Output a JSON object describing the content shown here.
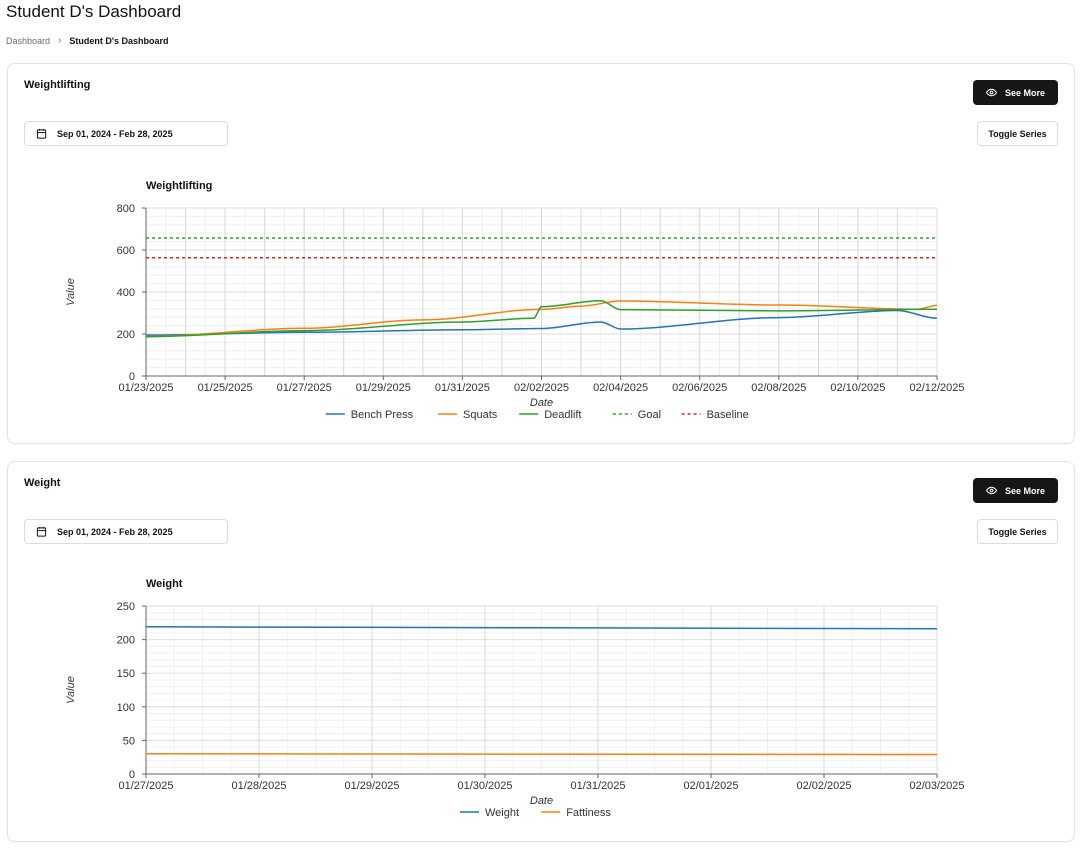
{
  "page": {
    "title": "Student D's Dashboard",
    "breadcrumb": {
      "parent": "Dashboard",
      "current": "Student D's Dashboard"
    }
  },
  "weightlifting_card": {
    "title": "Weightlifting",
    "see_more_label": "See More",
    "date_range": "Sep 01, 2024 - Feb 28, 2025",
    "toggle_label": "Toggle Series"
  },
  "weight_card": {
    "title": "Weight",
    "see_more_label": "See More",
    "date_range": "Sep 01, 2024 - Feb 28, 2025",
    "toggle_label": "Toggle Series"
  },
  "icons": {
    "see_more": "eye-icon",
    "date_range": "calendar-icon"
  },
  "chart_data": [
    {
      "type": "line",
      "title": "Weightlifting",
      "xlabel": "Date",
      "ylabel": "Value",
      "ylim": [
        0,
        800
      ],
      "yticks": [
        0,
        200,
        400,
        600,
        800
      ],
      "xlim": [
        "2025-01-23",
        "2025-02-12"
      ],
      "xticks": [
        "01/23/2025",
        "01/25/2025",
        "01/27/2025",
        "01/29/2025",
        "01/31/2025",
        "02/02/2025",
        "02/04/2025",
        "02/06/2025",
        "02/08/2025",
        "02/10/2025",
        "02/12/2025"
      ],
      "grid": true,
      "legend_position": "bottom",
      "series": [
        {
          "name": "Bench Press",
          "color": "#1f77b4",
          "style": "solid",
          "x": [
            "2025-01-23",
            "2025-01-27",
            "2025-01-31",
            "2025-02-02",
            "2025-02-03.5",
            "2025-02-04",
            "2025-02-08",
            "2025-02-11",
            "2025-02-12"
          ],
          "y": [
            195,
            208,
            220,
            226,
            257,
            224,
            278,
            312,
            275
          ]
        },
        {
          "name": "Squats",
          "color": "#ff7f0e",
          "style": "solid",
          "x": [
            "2025-01-23",
            "2025-01-27",
            "2025-01-30",
            "2025-02-02",
            "2025-02-03",
            "2025-02-04",
            "2025-02-08",
            "2025-02-11.5",
            "2025-02-12"
          ],
          "y": [
            188,
            227,
            267,
            317,
            333,
            357,
            338,
            318,
            336
          ]
        },
        {
          "name": "Deadlift",
          "color": "#2ca02c",
          "style": "solid",
          "x": [
            "2025-01-23",
            "2025-01-27",
            "2025-01-31",
            "2025-02-01.8",
            "2025-02-02",
            "2025-02-03.5",
            "2025-02-04",
            "2025-02-08",
            "2025-02-12"
          ],
          "y": [
            187,
            216,
            257,
            275,
            330,
            358,
            316,
            310,
            318
          ]
        },
        {
          "name": "Goal",
          "color": "#2ca02c",
          "style": "dashed",
          "x": [
            "2025-01-23",
            "2025-02-12"
          ],
          "y": [
            657,
            657
          ]
        },
        {
          "name": "Baseline",
          "color": "#d62728",
          "style": "dashed",
          "x": [
            "2025-01-23",
            "2025-02-12"
          ],
          "y": [
            563,
            563
          ]
        }
      ]
    },
    {
      "type": "line",
      "title": "Weight",
      "xlabel": "Date",
      "ylabel": "Value",
      "ylim": [
        0,
        250
      ],
      "yticks": [
        0,
        50,
        100,
        150,
        200,
        250
      ],
      "xlim": [
        "2025-01-27",
        "2025-02-03"
      ],
      "xticks": [
        "01/27/2025",
        "01/28/2025",
        "01/29/2025",
        "01/30/2025",
        "01/31/2025",
        "02/01/2025",
        "02/02/2025",
        "02/03/2025"
      ],
      "grid": true,
      "legend_position": "bottom",
      "series": [
        {
          "name": "Weight",
          "color": "#1f77b4",
          "style": "solid",
          "x": [
            "2025-01-27",
            "2025-02-03"
          ],
          "y": [
            219,
            216
          ]
        },
        {
          "name": "Fattiness",
          "color": "#ff7f0e",
          "style": "solid",
          "x": [
            "2025-01-27",
            "2025-02-03"
          ],
          "y": [
            30,
            29
          ]
        }
      ]
    }
  ]
}
